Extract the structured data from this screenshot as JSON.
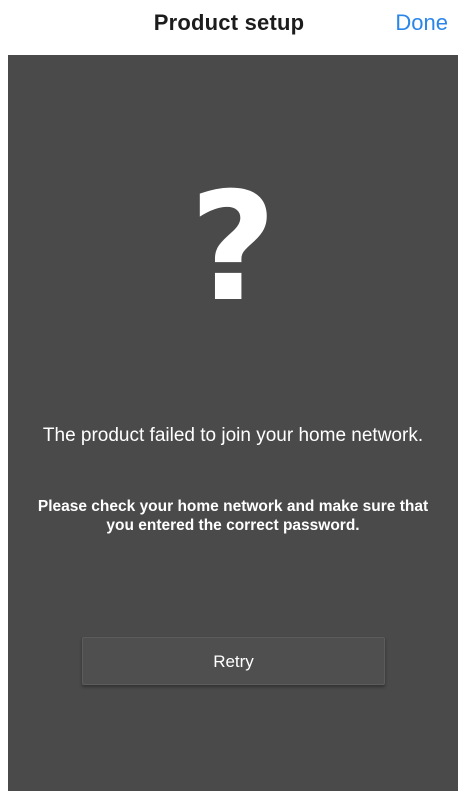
{
  "nav": {
    "title": "Product setup",
    "done_label": "Done"
  },
  "error": {
    "icon": "question-mark-icon",
    "icon_glyph": "?",
    "message": "The product failed to join your home network.",
    "hint": "Please check your home network and make sure that you entered the correct password."
  },
  "actions": {
    "retry_label": "Retry"
  },
  "colors": {
    "accent": "#2a86e8",
    "background": "#4a4a4a",
    "text": "#ffffff"
  }
}
